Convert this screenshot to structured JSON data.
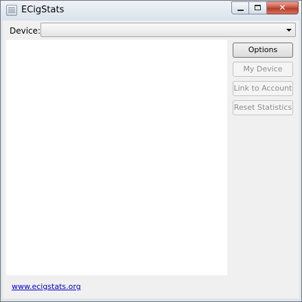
{
  "window": {
    "title": "ECigStats"
  },
  "device": {
    "label": "Device:",
    "selected": ""
  },
  "buttons": {
    "options": "Options",
    "my_device": "My Device",
    "link_account": "Link to Account",
    "reset_statistics": "Reset Statistics"
  },
  "footer": {
    "link_text": "www.ecigstats.org"
  },
  "colors": {
    "link": "#0000cc",
    "close_button": "#c9523f"
  }
}
